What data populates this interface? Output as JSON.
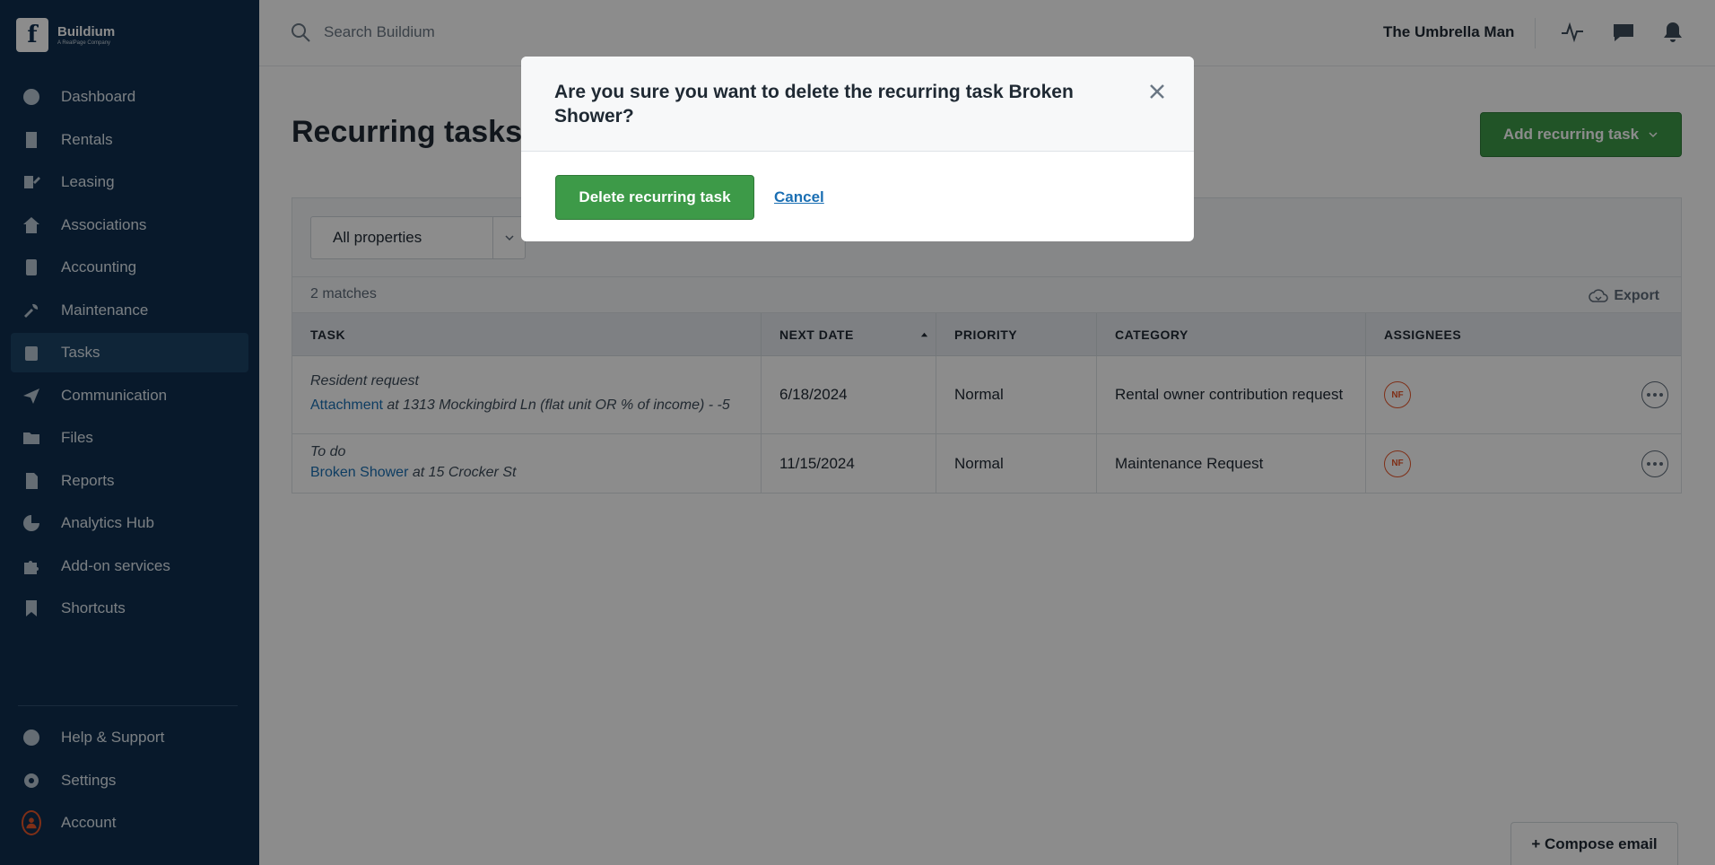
{
  "sidebar": {
    "logo": {
      "name": "Buildium",
      "tagline": "A RealPage Company"
    },
    "items": [
      {
        "label": "Dashboard",
        "icon": "dashboard-icon"
      },
      {
        "label": "Rentals",
        "icon": "building-icon"
      },
      {
        "label": "Leasing",
        "icon": "leasing-icon"
      },
      {
        "label": "Associations",
        "icon": "associations-icon"
      },
      {
        "label": "Accounting",
        "icon": "calculator-icon"
      },
      {
        "label": "Maintenance",
        "icon": "wrench-icon"
      },
      {
        "label": "Tasks",
        "icon": "clipboard-icon",
        "active": true
      },
      {
        "label": "Communication",
        "icon": "paper-plane-icon"
      },
      {
        "label": "Files",
        "icon": "folder-icon"
      },
      {
        "label": "Reports",
        "icon": "report-icon"
      },
      {
        "label": "Analytics Hub",
        "icon": "pie-chart-icon"
      },
      {
        "label": "Add-on services",
        "icon": "puzzle-icon"
      },
      {
        "label": "Shortcuts",
        "icon": "bookmark-icon"
      }
    ],
    "bottom_items": [
      {
        "label": "Help & Support",
        "icon": "help-icon"
      },
      {
        "label": "Settings",
        "icon": "gear-icon"
      },
      {
        "label": "Account",
        "icon": "account-icon"
      }
    ]
  },
  "topbar": {
    "search_placeholder": "Search Buildium",
    "user_name": "The Umbrella Man"
  },
  "main": {
    "title": "Recurring tasks",
    "add_button": "Add recurring task",
    "filter": {
      "property_select": "All properties"
    },
    "matches": "2 matches",
    "export_label": "Export",
    "columns": [
      "TASK",
      "NEXT DATE",
      "PRIORITY",
      "CATEGORY",
      "ASSIGNEES"
    ],
    "rows": [
      {
        "type": "Resident request",
        "link": "Attachment",
        "location": "at 1313 Mockingbird Ln (flat unit OR % of income) - -5",
        "next_date": "6/18/2024",
        "priority": "Normal",
        "category": "Rental owner contribution request",
        "assignee": "NF"
      },
      {
        "type": "To do",
        "link": "Broken Shower",
        "location": "at 15 Crocker St",
        "next_date": "11/15/2024",
        "priority": "Normal",
        "category": "Maintenance Request",
        "assignee": "NF"
      }
    ],
    "compose_email": "+ Compose email"
  },
  "modal": {
    "title": "Are you sure you want to delete the recurring task Broken Shower?",
    "delete_button": "Delete recurring task",
    "cancel_link": "Cancel"
  },
  "colors": {
    "sidebar_bg": "#0f2f4f",
    "primary_green": "#3d9a48",
    "link_blue": "#1b6fb3",
    "badge_orange": "#e8572a"
  }
}
